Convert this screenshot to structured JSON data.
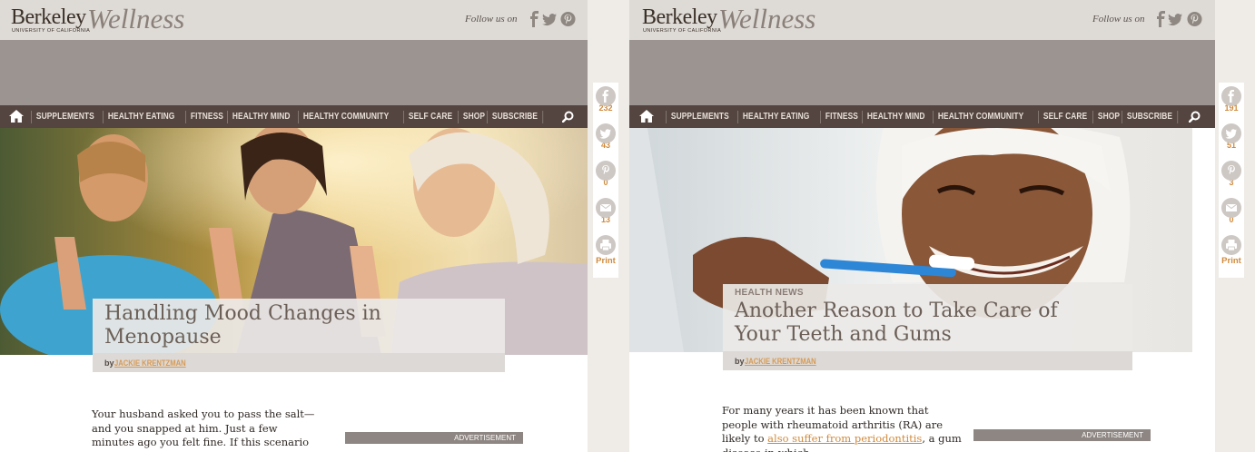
{
  "left": {
    "logo": {
      "brand": "Berkeley",
      "subbrand": "UNIVERSITY OF CALIFORNIA",
      "product": "Wellness"
    },
    "follow_label": "Follow us on",
    "nav": [
      "SUPPLEMENTS",
      "HEALTHY EATING",
      "FITNESS",
      "HEALTHY MIND",
      "HEALTHY COMMUNITY",
      "SELF CARE",
      "SHOP",
      "SUBSCRIBE"
    ],
    "article": {
      "title": "Handling Mood Changes in Menopause",
      "by": "by",
      "author": "JACKIE KRENTZMAN",
      "body": "Your husband asked you to pass the salt—and you snapped at him. Just a few minutes ago you felt fine. If this scenario sounds familiar,"
    },
    "ad_label": "ADVERTISEMENT",
    "share": {
      "facebook": "232",
      "twitter": "43",
      "pinterest": "0",
      "email": "13",
      "print": "Print"
    }
  },
  "right": {
    "logo": {
      "brand": "Berkeley",
      "subbrand": "UNIVERSITY OF CALIFORNIA",
      "product": "Wellness"
    },
    "follow_label": "Follow us on",
    "nav": [
      "SUPPLEMENTS",
      "HEALTHY EATING",
      "FITNESS",
      "HEALTHY MIND",
      "HEALTHY COMMUNITY",
      "SELF CARE",
      "SHOP",
      "SUBSCRIBE"
    ],
    "article": {
      "kicker": "HEALTH NEWS",
      "title": "Another Reason to Take Care of Your Teeth and Gums",
      "by": "by",
      "author": "JACKIE KRENTZMAN",
      "body_start": "For many years it has been known that people with rheumatoid arthritis (RA) are likely to ",
      "link": "also suffer from periodontitis",
      "body_end": ", a gum disease in which"
    },
    "ad_label": "ADVERTISEMENT",
    "share": {
      "facebook": "191",
      "twitter": "51",
      "pinterest": "3",
      "email": "0",
      "print": "Print"
    }
  },
  "colors": {
    "header": "#dedad6",
    "banner": "#9c9491",
    "nav": "#544540",
    "accent": "#d08a3c"
  },
  "icons": [
    "home-icon",
    "search-icon",
    "facebook-icon",
    "twitter-icon",
    "pinterest-icon",
    "email-icon",
    "print-icon"
  ]
}
